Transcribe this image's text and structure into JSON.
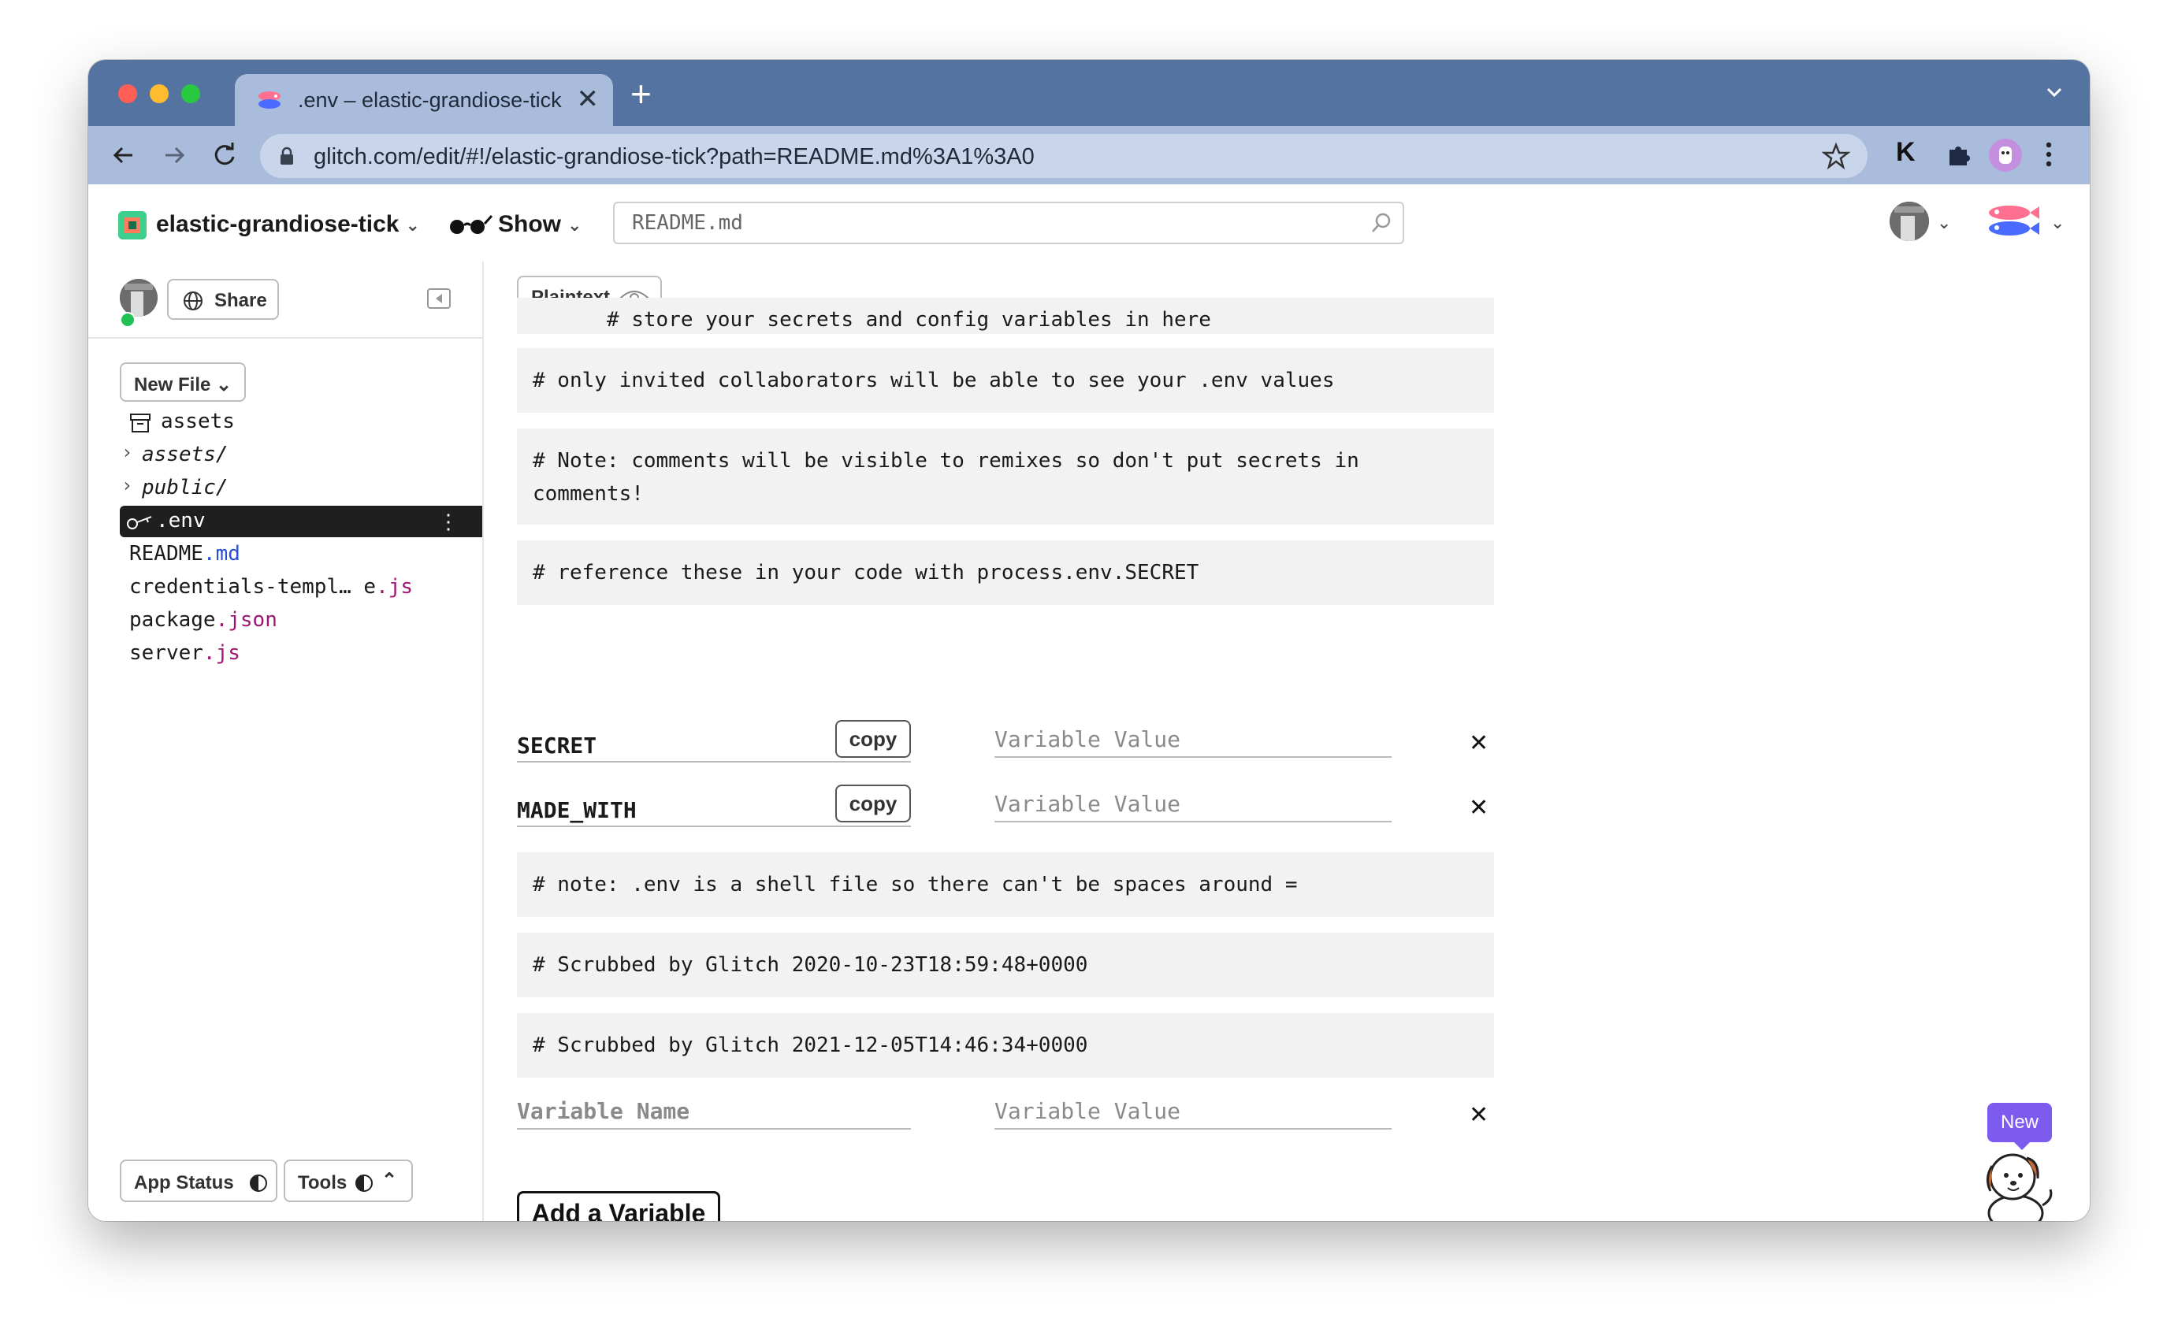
{
  "browser": {
    "tab_title": ".env – elastic-grandiose-tick",
    "tab_close": "✕",
    "new_tab": "+",
    "url": "glitch.com/edit/#!/elastic-grandiose-tick?path=README.md%3A1%3A0",
    "extension_letter": "K"
  },
  "header": {
    "project_name": "elastic-grandiose-tick",
    "show_label": "Show",
    "search_placeholder": "README.md"
  },
  "sidebar": {
    "share_label": "Share",
    "new_file_label": "New File",
    "files": [
      {
        "name": "assets",
        "ext": "",
        "kind": "assets"
      },
      {
        "name": "assets/",
        "ext": "",
        "kind": "folder"
      },
      {
        "name": "public/",
        "ext": "",
        "kind": "folder"
      },
      {
        "name": ".env",
        "ext": "",
        "kind": "env",
        "selected": true
      },
      {
        "name": "README",
        "ext": ".md",
        "kind": "file"
      },
      {
        "name": "credentials-templ… e",
        "ext": ".js",
        "kind": "file"
      },
      {
        "name": "package",
        "ext": ".json",
        "kind": "file"
      },
      {
        "name": "server",
        "ext": ".js",
        "kind": "file"
      }
    ],
    "app_status_label": "App Status",
    "tools_label": "Tools"
  },
  "editor": {
    "plaintext_label": "Plaintext",
    "comments": [
      "# store your secrets and config variables in here",
      "# only invited collaborators will be able to see your .env values",
      "# Note: comments will be visible to remixes so don't put secrets in comments!",
      "# reference these in your code with process.env.SECRET",
      "# note: .env is a shell file so there can't be spaces around =",
      "# Scrubbed by Glitch 2020-10-23T18:59:48+0000",
      "# Scrubbed by Glitch 2021-12-05T14:46:34+0000"
    ],
    "variables": [
      {
        "name": "SECRET",
        "value": "",
        "value_placeholder": "Variable Value",
        "copy_label": "copy"
      },
      {
        "name": "MADE_WITH",
        "value": "",
        "value_placeholder": "Variable Value",
        "copy_label": "copy"
      }
    ],
    "new_var_name_placeholder": "Variable Name",
    "new_var_value_placeholder": "Variable Value",
    "delete_glyph": "✕",
    "add_variable_label": "Add a Variable"
  },
  "new_badge": "New",
  "colors": {
    "tabstrip": "#5473a1",
    "toolbar": "#a9bcdb",
    "selected_file": "#1f1f1f",
    "extension": "#a01570",
    "md_extension": "#2a4fd0",
    "new_badge": "#7e5bef",
    "online": "#21c055"
  }
}
